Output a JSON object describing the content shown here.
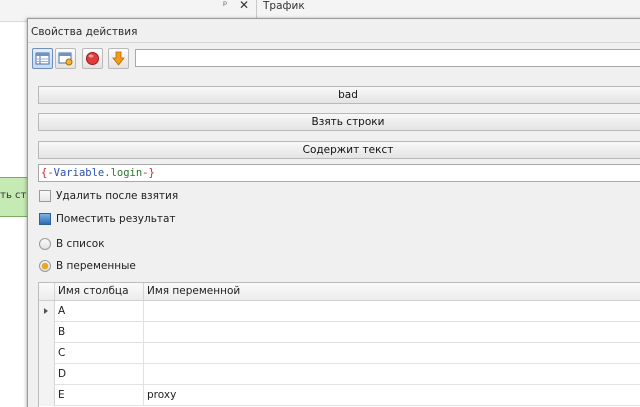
{
  "background": {
    "pin_glyph": "ᵖ",
    "close_glyph": "✕",
    "traffic_tab": "Трафик",
    "node_label": "ать стро"
  },
  "dialog": {
    "title": "Свойства действия",
    "toolbar": {
      "icons": [
        "table-view-icon",
        "window-settings-icon",
        "red-circle-icon",
        "orange-down-arrow-icon"
      ],
      "input_value": ""
    },
    "buttons": {
      "bad": "bad",
      "take_rows": "Взять строки",
      "contains_text": "Содержит текст"
    },
    "variable_input": {
      "open": "{",
      "dash1": "-",
      "var": "Variable",
      "dot": ".",
      "prop": "login",
      "dash2": "-",
      "close": "}"
    },
    "options": {
      "delete_after_take": {
        "label": "Удалить после взятия",
        "checked": false
      },
      "put_result": {
        "label": "Поместить результат"
      },
      "to_list": {
        "label": "В список",
        "selected": false
      },
      "to_variables": {
        "label": "В переменные",
        "selected": true
      }
    },
    "grid": {
      "headers": {
        "column_name": "Имя столбца",
        "variable_name": "Имя переменной"
      },
      "rows": [
        {
          "column": "A",
          "variable": ""
        },
        {
          "column": "B",
          "variable": ""
        },
        {
          "column": "C",
          "variable": ""
        },
        {
          "column": "D",
          "variable": ""
        },
        {
          "column": "E",
          "variable": "proxy"
        }
      ]
    }
  },
  "colors": {
    "node_green": "#c6eab4",
    "radio_accent": "#e8a91c",
    "brace_red": "#c7253e",
    "variable_blue": "#2b4fb3",
    "property_green": "#2a7a2a"
  }
}
